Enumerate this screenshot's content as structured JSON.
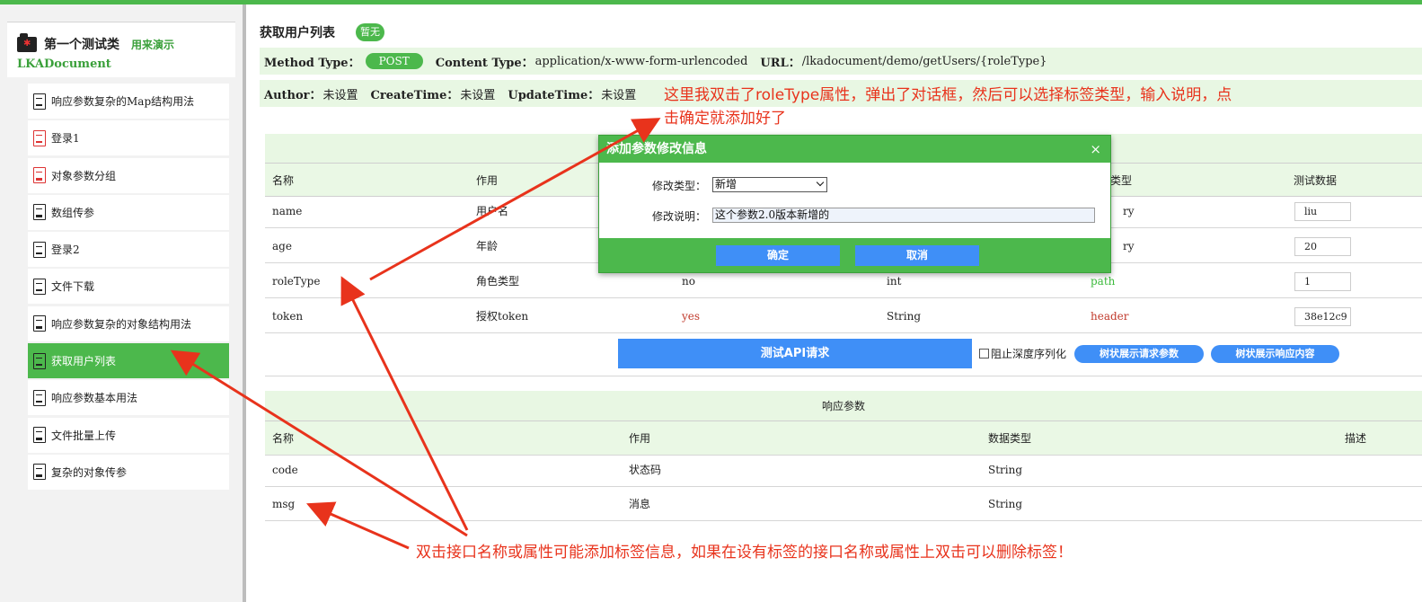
{
  "sidebar": {
    "class_title": "第一个测试类",
    "class_sub": "用来演示",
    "class_name": "LKADocument",
    "items": [
      {
        "label": "响应参数复杂的Map结构用法",
        "icon": "doc-icon"
      },
      {
        "label": "登录1",
        "icon": "doc-icon-red"
      },
      {
        "label": "对象参数分组",
        "icon": "doc-icon-red"
      },
      {
        "label": "数组传参",
        "icon": "doc-icon"
      },
      {
        "label": "登录2",
        "icon": "doc-icon"
      },
      {
        "label": "文件下载",
        "icon": "doc-icon"
      },
      {
        "label": "响应参数复杂的对象结构用法",
        "icon": "doc-icon"
      },
      {
        "label": "获取用户列表",
        "icon": "doc-icon",
        "active": true
      },
      {
        "label": "响应参数基本用法",
        "icon": "doc-icon"
      },
      {
        "label": "文件批量上传",
        "icon": "doc-icon"
      },
      {
        "label": "复杂的对象传参",
        "icon": "doc-icon"
      }
    ]
  },
  "api": {
    "title": "获取用户列表",
    "badge": "暂无",
    "method_label": "Method Type：",
    "method": "POST",
    "content_type_label": "Content Type：",
    "content_type": "application/x-www-form-urlencoded",
    "url_label": "URL：",
    "url": "/lkadocument/demo/getUsers/{roleType}",
    "author_label": "Author：",
    "author": "未设置",
    "create_label": "CreateTime：",
    "create": "未设置",
    "update_label": "UpdateTime：",
    "update": "未设置"
  },
  "request_table": {
    "headers": {
      "name": "名称",
      "desc": "作用",
      "type": "类型",
      "test": "测试数据"
    },
    "rows": [
      {
        "name": "name",
        "desc": "用户名",
        "required": "",
        "type": "",
        "where": "",
        "test": "liu"
      },
      {
        "name": "age",
        "desc": "年龄",
        "required": "",
        "type": "",
        "where": "",
        "test": "20"
      },
      {
        "name": "roleType",
        "desc": "角色类型",
        "required": "no",
        "type": "int",
        "where": "path",
        "test": "1"
      },
      {
        "name": "token",
        "desc": "授权token",
        "required": "yes",
        "type": "String",
        "where": "header",
        "test": "38e12c9"
      }
    ],
    "partial": {
      "r1": "ry",
      "r2": "ry"
    }
  },
  "actions": {
    "test_button": "测试API请求",
    "checkbox_label": "阻止深度序列化",
    "tree_request": "树状展示请求参数",
    "tree_response": "树状展示响应内容"
  },
  "response_table": {
    "title": "响应参数",
    "headers": {
      "name": "名称",
      "desc": "作用",
      "type": "数据类型",
      "remark": "描述"
    },
    "rows": [
      {
        "name": "code",
        "desc": "状态码",
        "type": "String"
      },
      {
        "name": "msg",
        "desc": "消息",
        "type": "String"
      }
    ]
  },
  "dialog": {
    "title": "添加参数修改信息",
    "close": "×",
    "type_label": "修改类型：",
    "type_value": "新增",
    "desc_label": "修改说明：",
    "desc_value": "这个参数2.0版本新增的",
    "ok": "确定",
    "cancel": "取消"
  },
  "annotations": {
    "top_line1": "这里我双击了roleType属性，弹出了对话框，然后可以选择标签类型，输入说明，点",
    "top_line2": "击确定就添加好了",
    "bottom": "双击接口名称或属性可能添加标签信息，如果在设有标签的接口名称或属性上双击可以删除标签！"
  },
  "colors": {
    "accent": "#4cb84c",
    "button": "#3f8ff7",
    "annotation": "#e8331c",
    "light_green": "#e8f7e3"
  }
}
